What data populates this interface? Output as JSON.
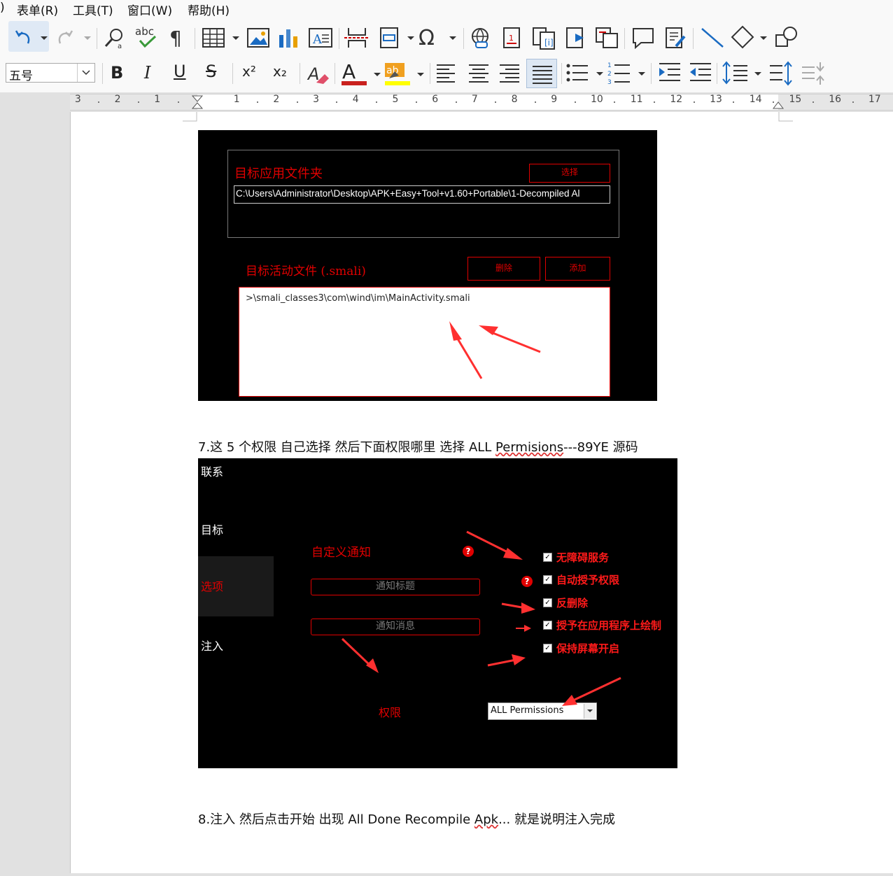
{
  "menu": {
    "items": [
      ")",
      "表单(R)",
      "工具(T)",
      "窗口(W)",
      "帮助(H)"
    ]
  },
  "toolbar": {
    "font_size_value": "五号",
    "bold": "B",
    "italic": "I",
    "underline": "U",
    "strike": "S",
    "superscript": "x²",
    "subscript": "x₂"
  },
  "ruler": {
    "numbers": [
      "3",
      "2",
      "1",
      "1",
      "2",
      "3",
      "4",
      "5",
      "6",
      "7",
      "8",
      "9",
      "10",
      "11",
      "12",
      "13",
      "14",
      "15",
      "16",
      "17"
    ]
  },
  "document": {
    "img1": {
      "target_folder_label": "目标应用文件夹",
      "select_button": "选择",
      "folder_path": "C:\\Users\\Administrator\\Desktop\\APK+Easy+Tool+v1.60+Portable\\1-Decompiled Al",
      "activity_label": "目标活动文件 (.smali)",
      "delete_button": "删除",
      "add_button": "添加",
      "activity_path": ">\\smali_classes3\\com\\wind\\im\\MainActivity.smali"
    },
    "step7_prefix": "7.这 5 个权限  自己选择  然后下面权限哪里  选择 ALL ",
    "step7_word": "Permisions",
    "step7_suffix": "---89YE 源码",
    "img2": {
      "side_contact": "联系",
      "side_target": "目标",
      "side_options": "选项",
      "side_inject": "注入",
      "custom_notify": "自定义通知",
      "notify_title_placeholder": "通知标题",
      "notify_msg_placeholder": "通知消息",
      "perm1": "无障碍服务",
      "perm2": "自动授予权限",
      "perm3": "反删除",
      "perm4": "授予在应用程序上绘制",
      "perm5": "保持屏幕开启",
      "perm_label": "权限",
      "perm_select": "ALL Permissions",
      "help_mark": "?"
    },
    "step8_prefix": "8.注入  然后点击开始  出现  All Done Recompile ",
    "step8_word": "Apk",
    "step8_suffix": "... 就是说明注入完成"
  },
  "colors": {
    "accent_red": "#e00000",
    "toolbar_bg": "#f9f9f9",
    "page_bg": "#ffffff"
  }
}
